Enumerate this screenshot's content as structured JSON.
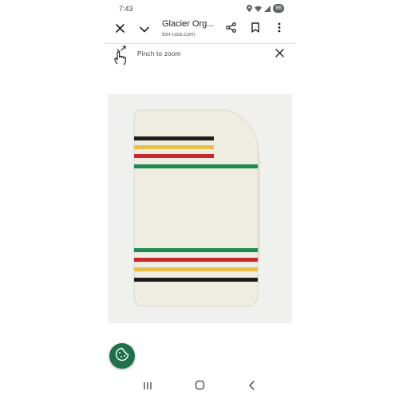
{
  "status_bar": {
    "time": "7:43",
    "battery": "86",
    "icons": [
      "location-icon",
      "wifi-icon",
      "signal-icon",
      "battery-icon"
    ]
  },
  "toolbar": {
    "title": "Glacier Org...",
    "url": "ton-usa.com",
    "actions": [
      "close-icon",
      "chevron-down-icon",
      "share-icon",
      "bookmark-icon",
      "more-vert-icon"
    ]
  },
  "hint": {
    "text": "Pinch to zoom",
    "icon": "pinch-gesture-icon"
  },
  "product": {
    "colors": {
      "blanket": "#efece2",
      "stripe_black": "#1d1d1d",
      "stripe_yellow": "#e7c04a",
      "stripe_red": "#c8282c",
      "stripe_green": "#1d8a52",
      "background": "#f0f0ef"
    }
  },
  "fab": {
    "icon": "cookie-icon",
    "color": "#1e6f4b"
  },
  "navbar": {
    "buttons": [
      "recent-apps-icon",
      "home-icon",
      "back-icon"
    ]
  }
}
